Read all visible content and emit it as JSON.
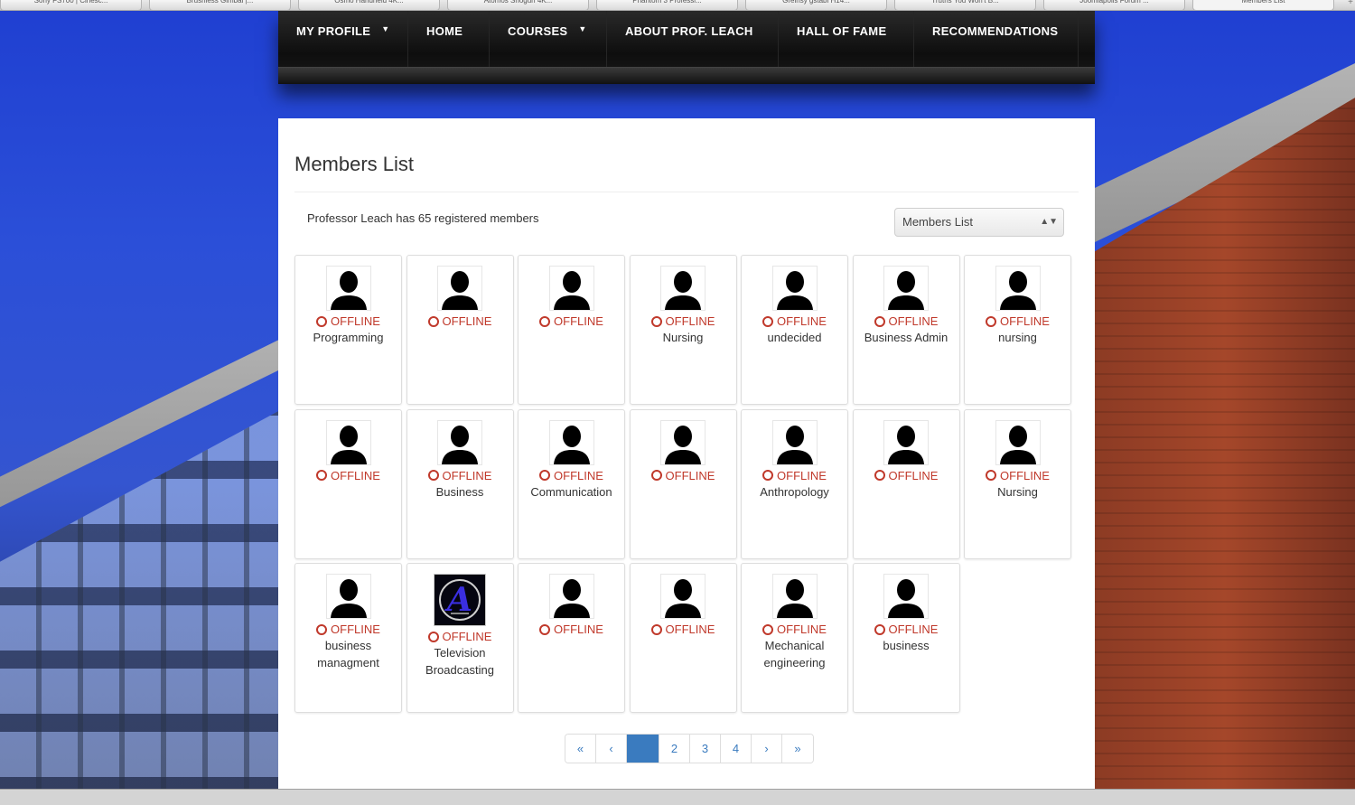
{
  "browser": {
    "tabs": [
      "Sony FS700 | Cinesc...",
      "Brushless Gimbal |...",
      "Osmo Handheld 4K...",
      "Atomos Shogun 4K...",
      "Phantom 3 Professi...",
      "Greinsy gstabi H14...",
      "Truths You Won't B...",
      "Joomlapolis Forum ...",
      "Members List"
    ],
    "add_tab": "+"
  },
  "nav": {
    "items": [
      {
        "label": "MY PROFILE",
        "has_caret": true
      },
      {
        "label": "HOME",
        "has_caret": false
      },
      {
        "label": "COURSES",
        "has_caret": true
      },
      {
        "label": "ABOUT PROF. LEACH",
        "has_caret": false
      },
      {
        "label": "HALL OF FAME",
        "has_caret": false
      },
      {
        "label": "RECOMMENDATIONS",
        "has_caret": false
      }
    ],
    "caret": "⌄"
  },
  "page": {
    "title": "Members List",
    "summary": "Professor Leach has 65 registered members",
    "select_value": "Members List",
    "select_arrows": "▲▼"
  },
  "members": [
    {
      "status": "OFFLINE",
      "major": "Programming",
      "avatar": "silhouette"
    },
    {
      "status": "OFFLINE",
      "major": "",
      "avatar": "silhouette"
    },
    {
      "status": "OFFLINE",
      "major": "",
      "avatar": "silhouette"
    },
    {
      "status": "OFFLINE",
      "major": "Nursing",
      "avatar": "silhouette"
    },
    {
      "status": "OFFLINE",
      "major": "undecided",
      "avatar": "silhouette"
    },
    {
      "status": "OFFLINE",
      "major": "Business Admin",
      "avatar": "silhouette"
    },
    {
      "status": "OFFLINE",
      "major": "nursing",
      "avatar": "silhouette"
    },
    {
      "status": "OFFLINE",
      "major": "",
      "avatar": "silhouette"
    },
    {
      "status": "OFFLINE",
      "major": "Business",
      "avatar": "silhouette"
    },
    {
      "status": "OFFLINE",
      "major": "Communication",
      "avatar": "silhouette"
    },
    {
      "status": "OFFLINE",
      "major": "",
      "avatar": "silhouette"
    },
    {
      "status": "OFFLINE",
      "major": "Anthropology",
      "avatar": "silhouette"
    },
    {
      "status": "OFFLINE",
      "major": "",
      "avatar": "silhouette"
    },
    {
      "status": "OFFLINE",
      "major": "Nursing",
      "avatar": "silhouette"
    },
    {
      "status": "OFFLINE",
      "major": "business managment",
      "avatar": "silhouette"
    },
    {
      "status": "OFFLINE",
      "major": "Television Broadcasting",
      "avatar": "logo"
    },
    {
      "status": "OFFLINE",
      "major": "",
      "avatar": "silhouette"
    },
    {
      "status": "OFFLINE",
      "major": "",
      "avatar": "silhouette"
    },
    {
      "status": "OFFLINE",
      "major": "Mechanical engineering",
      "avatar": "silhouette"
    },
    {
      "status": "OFFLINE",
      "major": "business",
      "avatar": "silhouette"
    }
  ],
  "pagination": {
    "first": "«",
    "prev": "‹",
    "current": "",
    "pages": [
      "2",
      "3",
      "4"
    ],
    "next": "›",
    "last": "»"
  },
  "colors": {
    "offline": "#c0392b",
    "link": "#3a7bbf",
    "nav_bg": "#111111"
  }
}
